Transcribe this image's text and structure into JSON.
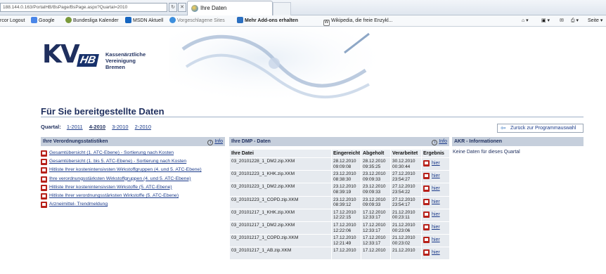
{
  "browser": {
    "url": "188.144.0.163/PortalHB/BsPage/BsPage.aspx?Quartal=2010",
    "tab_title": "Ihre Daten",
    "favorites": [
      {
        "label": "rcor Logout",
        "icon": "none"
      },
      {
        "label": "Google",
        "icon": "google-icon"
      },
      {
        "label": "Bundesliga Kalender",
        "icon": "ball-icon"
      },
      {
        "label": "MSDN Aktuell",
        "icon": "msdn-icon"
      },
      {
        "label": "Vorgeschlagene Sites",
        "icon": "ie-icon"
      },
      {
        "label": "Mehr Add-ons erhalten",
        "icon": "addons-icon"
      },
      {
        "label": "Wikipedia, die freie Enzykl...",
        "icon": "wikipedia-icon"
      }
    ],
    "toolbar_right": "Seite"
  },
  "header": {
    "logo_main": "KV",
    "logo_sub": "HB",
    "logo_text": [
      "Kassenärztliche",
      "Vereinigung",
      "Bremen"
    ]
  },
  "page": {
    "title": "Für Sie bereitgestellte Daten",
    "quartal_label": "Quartal:",
    "quartals": [
      "1-2011",
      "4-2010",
      "3-2010",
      "2-2010"
    ],
    "active_quartal": "4-2010",
    "back_button": "Zurück zur Programmauswahl"
  },
  "panels": {
    "stats": {
      "title": "Ihre Verordnungsstatistiken",
      "info": "Info",
      "items": [
        "Gesamtübersicht (1. ATC-Ebene) - Sortierung nach Kosten",
        "Gesamtübersicht (1. bis 5. ATC-Ebene) - Sortierung nach Kosten",
        "Hitliste Ihrer kostenintensivsten Wirkstoffgruppen (4. und 5. ATC-Ebene)",
        "Ihre verordnungsstärksten Wirkstoffgruppen (4. und 5. ATC-Ebene)",
        "Hitliste Ihrer kostenintensivsten Wirkstoffe (5. ATC-Ebene)",
        "Hitliste Ihrer verordnungsstärksten Wirkstoffe (5. ATC-Ebene)",
        "Arzneimittel- Trendmeldung"
      ]
    },
    "dmp": {
      "title": "Ihre DMP - Daten",
      "info": "Info",
      "columns": [
        "Ihre Datei",
        "Eingereicht",
        "Abgeholt",
        "Verarbeitet",
        "Ergebnis"
      ],
      "rows": [
        {
          "file": "03_20101228_1_DM2.zip.XKM",
          "eingereicht": [
            "28.12.2010",
            "09:09:08"
          ],
          "abgeholt": [
            "28.12.2010",
            "09:35:25"
          ],
          "verarbeitet": [
            "30.12.2010",
            "00:30:44"
          ],
          "ergebnis": "hier"
        },
        {
          "file": "03_20101223_1_KHK.zip.XKM",
          "eingereicht": [
            "23.12.2010",
            "08:38:30"
          ],
          "abgeholt": [
            "23.12.2010",
            "09:09:33"
          ],
          "verarbeitet": [
            "27.12.2010",
            "23:54:27"
          ],
          "ergebnis": "hier"
        },
        {
          "file": "03_20101223_1_DM2.zip.XKM",
          "eingereicht": [
            "23.12.2010",
            "08:39:19"
          ],
          "abgeholt": [
            "23.12.2010",
            "09:09:33"
          ],
          "verarbeitet": [
            "27.12.2010",
            "23:54:22"
          ],
          "ergebnis": "hier"
        },
        {
          "file": "03_20101223_1_COPD.zip.XKM",
          "eingereicht": [
            "23.12.2010",
            "08:39:12"
          ],
          "abgeholt": [
            "23.12.2010",
            "09:09:33"
          ],
          "verarbeitet": [
            "27.12.2010",
            "23:54:17"
          ],
          "ergebnis": "hier"
        },
        {
          "file": "03_20101217_1_KHK.zip.XKM",
          "eingereicht": [
            "17.12.2010",
            "12:22:15"
          ],
          "abgeholt": [
            "17.12.2010",
            "12:33:17"
          ],
          "verarbeitet": [
            "21.12.2010",
            "00:23:11"
          ],
          "ergebnis": "hier"
        },
        {
          "file": "03_20101217_1_DM2.zip.XKM",
          "eingereicht": [
            "17.12.2010",
            "12:22:06"
          ],
          "abgeholt": [
            "17.12.2010",
            "12:33:17"
          ],
          "verarbeitet": [
            "21.12.2010",
            "00:23:06"
          ],
          "ergebnis": "hier"
        },
        {
          "file": "03_20101217_1_COPD.zip.XKM",
          "eingereicht": [
            "17.12.2010",
            "12:21:49"
          ],
          "abgeholt": [
            "17.12.2010",
            "12:33:17"
          ],
          "verarbeitet": [
            "21.12.2010",
            "00:23:02"
          ],
          "ergebnis": "hier"
        },
        {
          "file": "03_20101217_1_AB.zip.XKM",
          "eingereicht": [
            "17.12.2010",
            ""
          ],
          "abgeholt": [
            "17.12.2010",
            ""
          ],
          "verarbeitet": [
            "21.12.2010",
            ""
          ],
          "ergebnis": "hier"
        }
      ]
    },
    "akr": {
      "title": "AKR - Informationen",
      "note": "Keine Daten für dieses Quartal"
    }
  },
  "colors": {
    "brand": "#1f2f5e",
    "panel_header": "#c6cfdc",
    "cell_bg": "#e6eaef",
    "pdf_red": "#b7211a",
    "link": "#1a3a8a"
  }
}
